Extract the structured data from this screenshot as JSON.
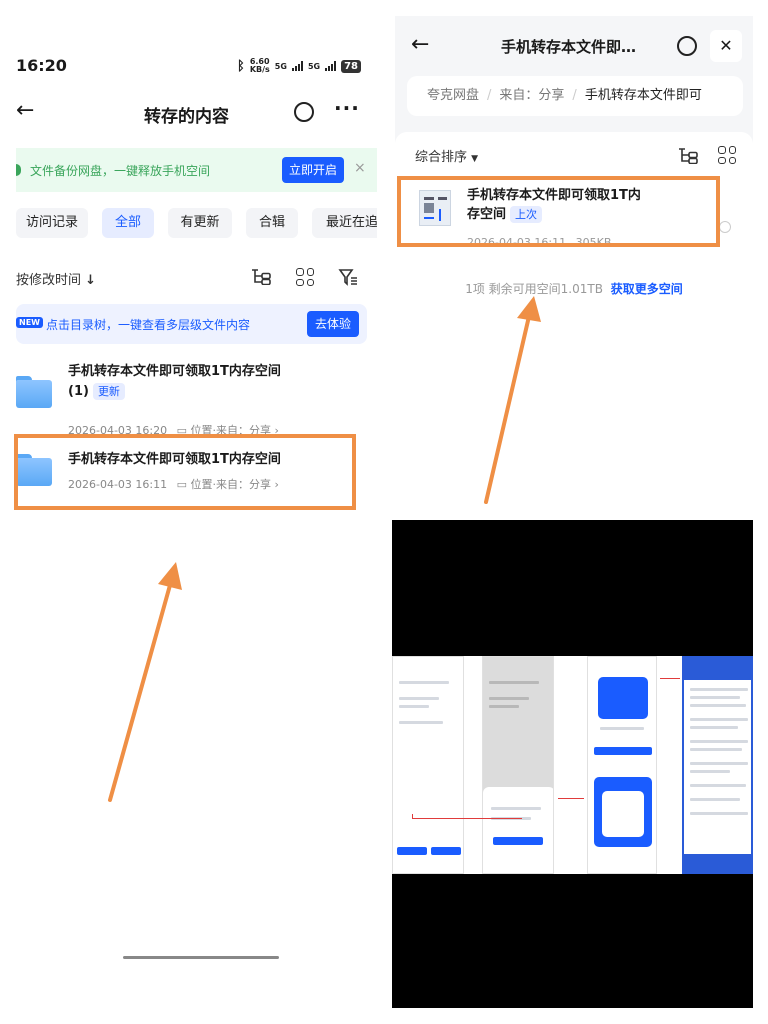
{
  "left": {
    "status": {
      "time": "16:20",
      "speed_top": "6.60",
      "speed_unit": "KB/s",
      "net1": "5G",
      "net2": "5G",
      "battery": "78"
    },
    "title": "转存的内容",
    "banner": {
      "text": "文件备份网盘，一键释放手机空间",
      "button": "立即开启",
      "close": "×"
    },
    "chips": [
      "访问记录",
      "全部",
      "有更新",
      "合辑",
      "最近在追"
    ],
    "sort_label": "按修改时间",
    "tip": {
      "badge": "NEW",
      "text": "点击目录树，一键查看多层级文件内容",
      "button": "去体验"
    },
    "files": [
      {
        "name_line1": "手机转存本文件即可领取1T内存空间",
        "name_line2": "(1)",
        "badge": "更新",
        "date": "2026-04-03 16:20",
        "location": "位置·来自：分享"
      },
      {
        "name_line1": "手机转存本文件即可领取1T内存空间",
        "date": "2026-04-03 16:11",
        "location": "位置·来自：分享"
      }
    ]
  },
  "right_top": {
    "title": "手机转存本文件即…",
    "crumbs": [
      "夸克网盘",
      "来自：分享",
      "手机转存本文件即可"
    ],
    "sort": "综合排序",
    "item": {
      "name_line1": "手机转存本文件即可领取1T内",
      "name_line2": "存空间",
      "badge": "上次",
      "date": "2026-04-03 16:11",
      "size": "305KB"
    },
    "footer": {
      "count": "1项",
      "space": "剩余可用空间1.01TB",
      "link": "获取更多空间"
    }
  },
  "colors": {
    "accent": "#1a5cff",
    "highlight": "#ef8f45",
    "green": "#3aa55b"
  },
  "icons": [
    "back-arrow-icon",
    "search-icon",
    "more-icon",
    "tree-icon",
    "grid-icon",
    "filter-icon",
    "folder-icon",
    "close-icon",
    "bluetooth-icon",
    "signal-icon"
  ]
}
